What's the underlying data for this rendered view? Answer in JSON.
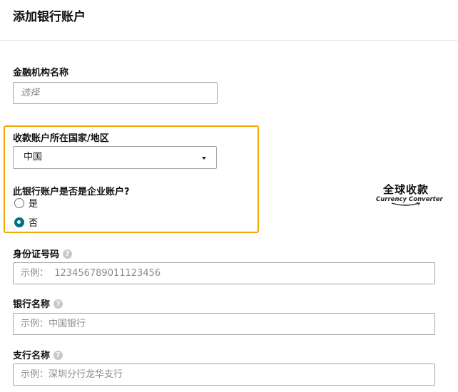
{
  "page": {
    "title": "添加银行账户"
  },
  "institution": {
    "label": "金融机构名称",
    "placeholder": "选择"
  },
  "country": {
    "label": "收款账户所在国家/地区",
    "selected": "中国"
  },
  "business_account": {
    "question": "此银行账户是否是企业账户?",
    "options": [
      {
        "label": "是",
        "checked": false
      },
      {
        "label": "否",
        "checked": true
      }
    ]
  },
  "id_number": {
    "label": "身份证号码",
    "placeholder": "示例：  123456789011123456"
  },
  "bank_name": {
    "label": "银行名称",
    "placeholder": "示例：中国银行"
  },
  "branch_name": {
    "label": "支行名称",
    "placeholder": "示例：深圳分行龙华支行"
  },
  "logo": {
    "cn": "全球收款",
    "en": "Currency Converter"
  },
  "colors": {
    "highlight": "#f0a500",
    "radio_checked": "#007185",
    "border": "#a6a6a6"
  }
}
